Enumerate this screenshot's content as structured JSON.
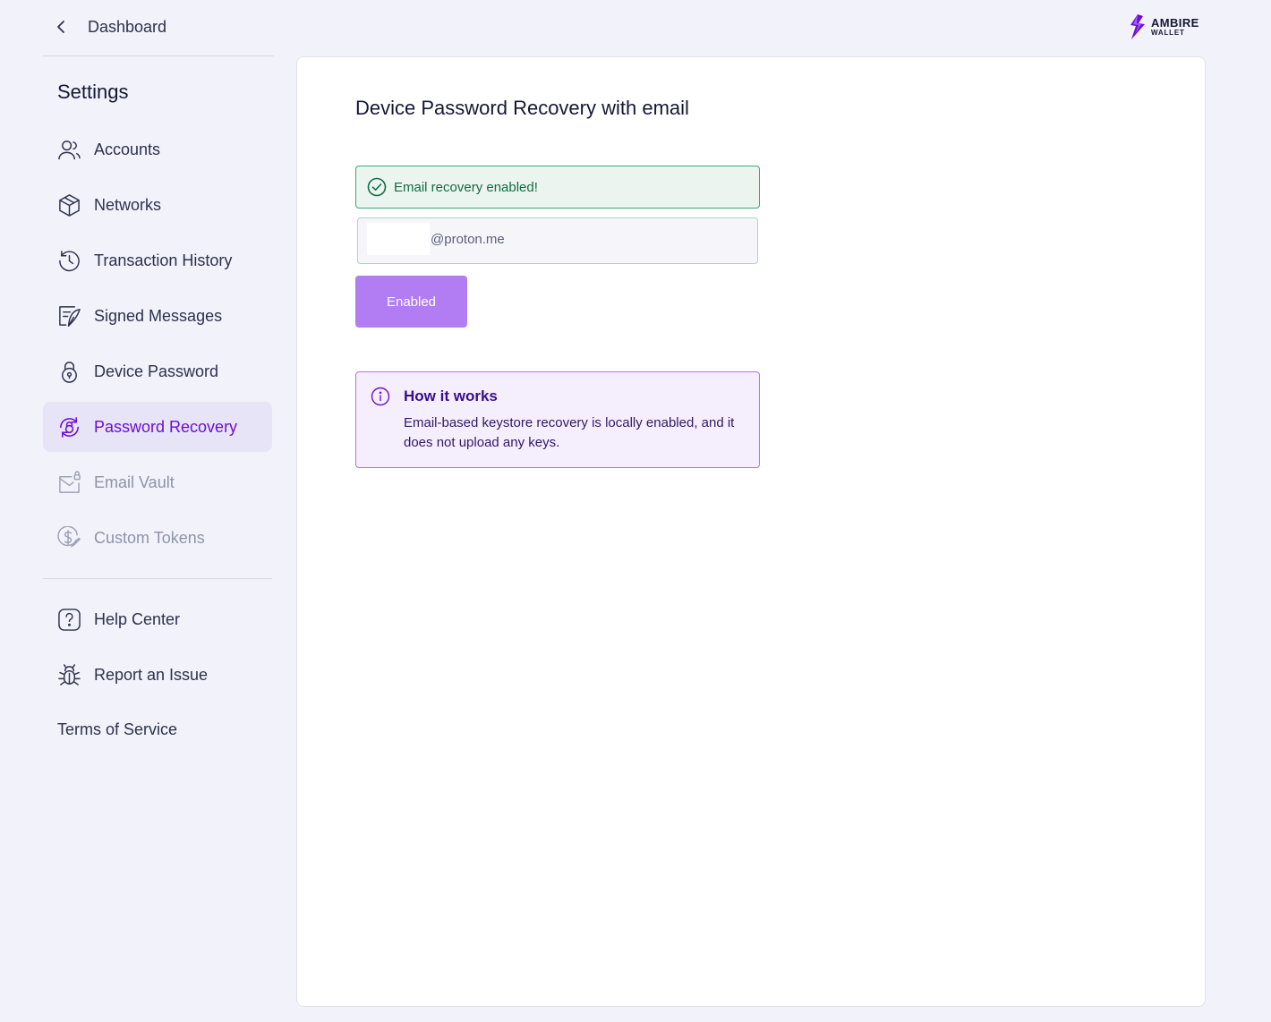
{
  "header": {
    "back_label": "Dashboard",
    "logo": {
      "line1": "AMBIRE",
      "line2": "WALLET"
    }
  },
  "sidebar": {
    "title": "Settings",
    "items": [
      {
        "label": "Accounts",
        "icon": "accounts-icon",
        "state": "normal"
      },
      {
        "label": "Networks",
        "icon": "networks-icon",
        "state": "normal"
      },
      {
        "label": "Transaction History",
        "icon": "history-icon",
        "state": "normal"
      },
      {
        "label": "Signed Messages",
        "icon": "signed-messages-icon",
        "state": "normal"
      },
      {
        "label": "Device Password",
        "icon": "lock-icon",
        "state": "normal"
      },
      {
        "label": "Password Recovery",
        "icon": "recovery-icon",
        "state": "active"
      },
      {
        "label": "Email Vault",
        "icon": "email-vault-icon",
        "state": "disabled"
      },
      {
        "label": "Custom Tokens",
        "icon": "custom-tokens-icon",
        "state": "disabled"
      }
    ],
    "secondary": [
      {
        "label": "Help Center",
        "icon": "help-icon"
      },
      {
        "label": "Report an Issue",
        "icon": "bug-icon"
      }
    ],
    "terms_label": "Terms of Service"
  },
  "main": {
    "title": "Device Password Recovery with email",
    "success_message": "Email recovery enabled!",
    "email_domain": "@proton.me",
    "button_label": "Enabled",
    "info": {
      "title": "How it works",
      "body": "Email-based keystore recovery is locally enabled, and it does not upload any keys."
    }
  },
  "colors": {
    "accent": "#6b0fd6",
    "button": "#b27cf2",
    "success": "#3ea776",
    "info_border": "#b66ff0",
    "background": "#f2f2fa"
  }
}
